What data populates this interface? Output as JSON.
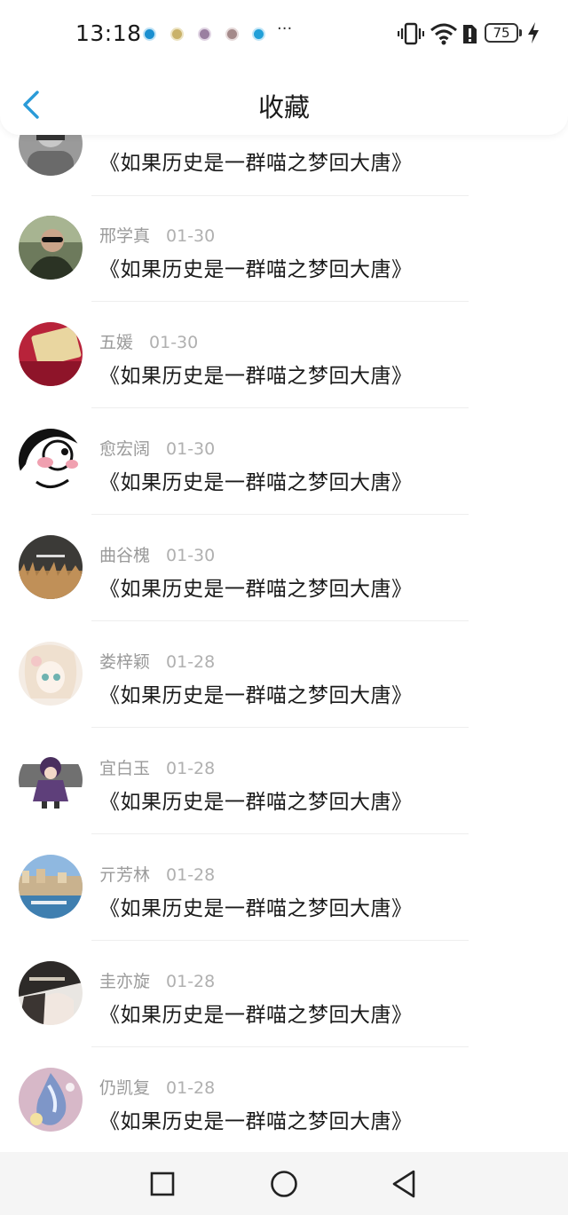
{
  "status_bar": {
    "time": "13:18",
    "overflow": "···",
    "battery": "75"
  },
  "header": {
    "title": "收藏"
  },
  "items": [
    {
      "author": "",
      "date": "",
      "headline": "《如果历史是一群喵之梦回大唐》",
      "avatar": "avatar-grayscale-portrait"
    },
    {
      "author": "邢学真",
      "date": "01-30",
      "headline": "《如果历史是一群喵之梦回大唐》",
      "avatar": "avatar-sunglasses-man"
    },
    {
      "author": "五媛",
      "date": "01-30",
      "headline": "《如果历史是一群喵之梦回大唐》",
      "avatar": "avatar-red-envelope"
    },
    {
      "author": "愈宏阔",
      "date": "01-30",
      "headline": "《如果历史是一群喵之梦回大唐》",
      "avatar": "avatar-blushing-cartoon"
    },
    {
      "author": "曲谷槐",
      "date": "01-30",
      "headline": "《如果历史是一群喵之梦回大唐》",
      "avatar": "avatar-reed-field"
    },
    {
      "author": "娄梓颖",
      "date": "01-28",
      "headline": "《如果历史是一群喵之梦回大唐》",
      "avatar": "avatar-anime-girl"
    },
    {
      "author": "宜白玉",
      "date": "01-28",
      "headline": "《如果历史是一群喵之梦回大唐》",
      "avatar": "avatar-chibi-warrior"
    },
    {
      "author": "亓芳林",
      "date": "01-28",
      "headline": "《如果历史是一群喵之梦回大唐》",
      "avatar": "avatar-harbor-town"
    },
    {
      "author": "圭亦旋",
      "date": "01-28",
      "headline": "《如果历史是一群喵之梦回大唐》",
      "avatar": "avatar-dark-portrait"
    },
    {
      "author": "仍凯复",
      "date": "01-28",
      "headline": "《如果历史是一群喵之梦回大唐》",
      "avatar": "avatar-water-drop"
    }
  ],
  "nav": {
    "recents": "square-icon",
    "home": "circle-icon",
    "back": "triangle-back-icon"
  },
  "colors": {
    "accent": "#2a9bd8",
    "text": "#1a1a1a",
    "meta": "#9a9a9a"
  }
}
